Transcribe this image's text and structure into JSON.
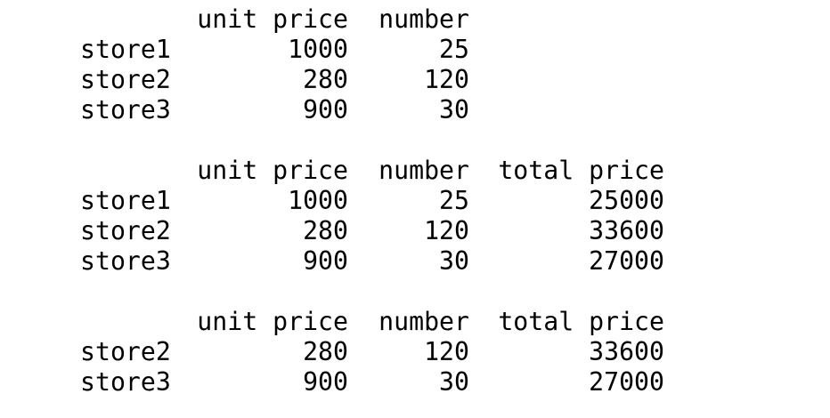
{
  "output": {
    "dataframes": [
      {
        "columns": [
          "unit price",
          "number"
        ],
        "rows": [
          {
            "index": "store1",
            "values": [
              "1000",
              "25"
            ]
          },
          {
            "index": "store2",
            "values": [
              "280",
              "120"
            ]
          },
          {
            "index": "store3",
            "values": [
              "900",
              "30"
            ]
          }
        ]
      },
      {
        "columns": [
          "unit price",
          "number",
          "total price"
        ],
        "rows": [
          {
            "index": "store1",
            "values": [
              "1000",
              "25",
              "25000"
            ]
          },
          {
            "index": "store2",
            "values": [
              "280",
              "120",
              "33600"
            ]
          },
          {
            "index": "store3",
            "values": [
              "900",
              "30",
              "27000"
            ]
          }
        ]
      },
      {
        "columns": [
          "unit price",
          "number",
          "total price"
        ],
        "rows": [
          {
            "index": "store2",
            "values": [
              "280",
              "120",
              "33600"
            ]
          },
          {
            "index": "store3",
            "values": [
              "900",
              "30",
              "27000"
            ]
          }
        ]
      }
    ]
  }
}
